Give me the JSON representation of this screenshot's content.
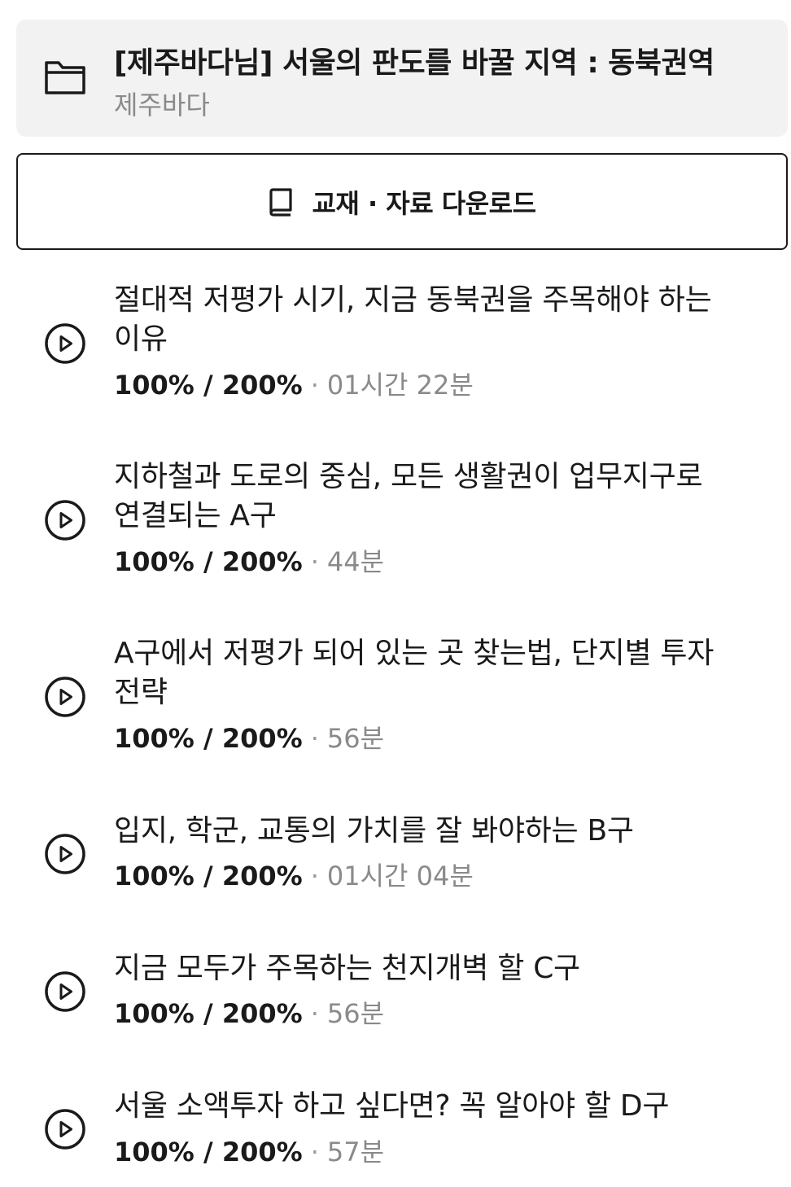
{
  "course": {
    "title": "[제주바다님] 서울의 판도를 바꿀 지역 : 동북권역",
    "author": "제주바다",
    "icon": "folder-icon"
  },
  "download_button": {
    "label": "교재 · 자료 다운로드",
    "icon": "book-icon"
  },
  "lectures": [
    {
      "title": "절대적 저평가 시기, 지금 동북권을 주목해야 하는 이유",
      "speed": "100% / 200%",
      "separator": "·",
      "duration": "01시간 22분"
    },
    {
      "title": "지하철과 도로의 중심, 모든 생활권이 업무지구로 연결되는 A구",
      "speed": "100% / 200%",
      "separator": "·",
      "duration": "44분"
    },
    {
      "title": "A구에서 저평가 되어 있는 곳 찾는법, 단지별 투자 전략",
      "speed": "100% / 200%",
      "separator": "·",
      "duration": "56분"
    },
    {
      "title": "입지, 학군, 교통의 가치를 잘 봐야하는 B구",
      "speed": "100% / 200%",
      "separator": "·",
      "duration": "01시간 04분"
    },
    {
      "title": "지금 모두가 주목하는 천지개벽 할 C구",
      "speed": "100% / 200%",
      "separator": "·",
      "duration": "56분"
    },
    {
      "title": "서울 소액투자 하고 싶다면? 꼭 알아야 할 D구",
      "speed": "100% / 200%",
      "separator": "·",
      "duration": "57분"
    }
  ],
  "colors": {
    "header_bg": "#f2f2f2",
    "text_primary": "#1a1a1a",
    "text_secondary": "#8a8a8a"
  }
}
